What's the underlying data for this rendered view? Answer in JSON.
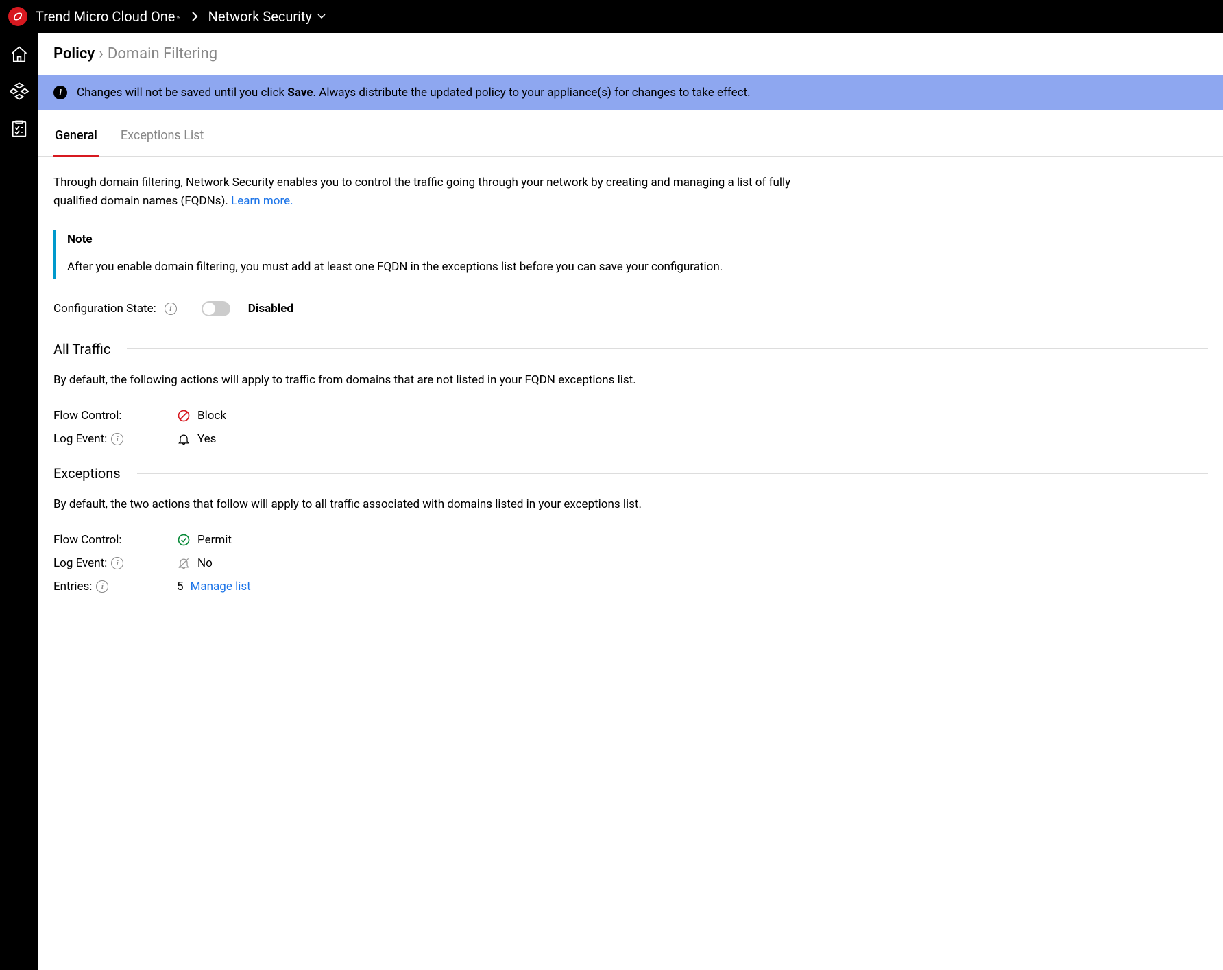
{
  "header": {
    "brand": "Trend Micro Cloud One",
    "tm": "™",
    "product": "Network Security"
  },
  "breadcrumb": {
    "root": "Policy",
    "separator": "›",
    "current": "Domain Filtering"
  },
  "banner": {
    "prefix": "Changes will not be saved until you click ",
    "bold": "Save",
    "suffix": ". Always distribute the updated policy to your appliance(s) for changes to take effect."
  },
  "tabs": {
    "general": "General",
    "exceptions": "Exceptions List"
  },
  "intro": {
    "text": "Through domain filtering, Network Security enables you to control the traffic going through your network by creating and managing a list of fully qualified domain names (FQDNs). ",
    "learn_more": "Learn more."
  },
  "note": {
    "title": "Note",
    "body": "After you enable domain filtering, you must add at least one FQDN in the exceptions list before you can save your configuration."
  },
  "config": {
    "label": "Configuration State:",
    "state": "Disabled"
  },
  "all_traffic": {
    "title": "All Traffic",
    "desc": "By default, the following actions will apply to traffic from domains that are not listed in your FQDN exceptions list.",
    "flow_control_label": "Flow Control:",
    "flow_control_value": "Block",
    "log_event_label": "Log Event:",
    "log_event_value": "Yes"
  },
  "exceptions": {
    "title": "Exceptions",
    "desc": "By default, the two actions that follow will apply to all traffic associated with domains listed in your exceptions list.",
    "flow_control_label": "Flow Control:",
    "flow_control_value": "Permit",
    "log_event_label": "Log Event:",
    "log_event_value": "No",
    "entries_label": "Entries:",
    "entries_count": "5",
    "manage_link": "Manage list"
  }
}
